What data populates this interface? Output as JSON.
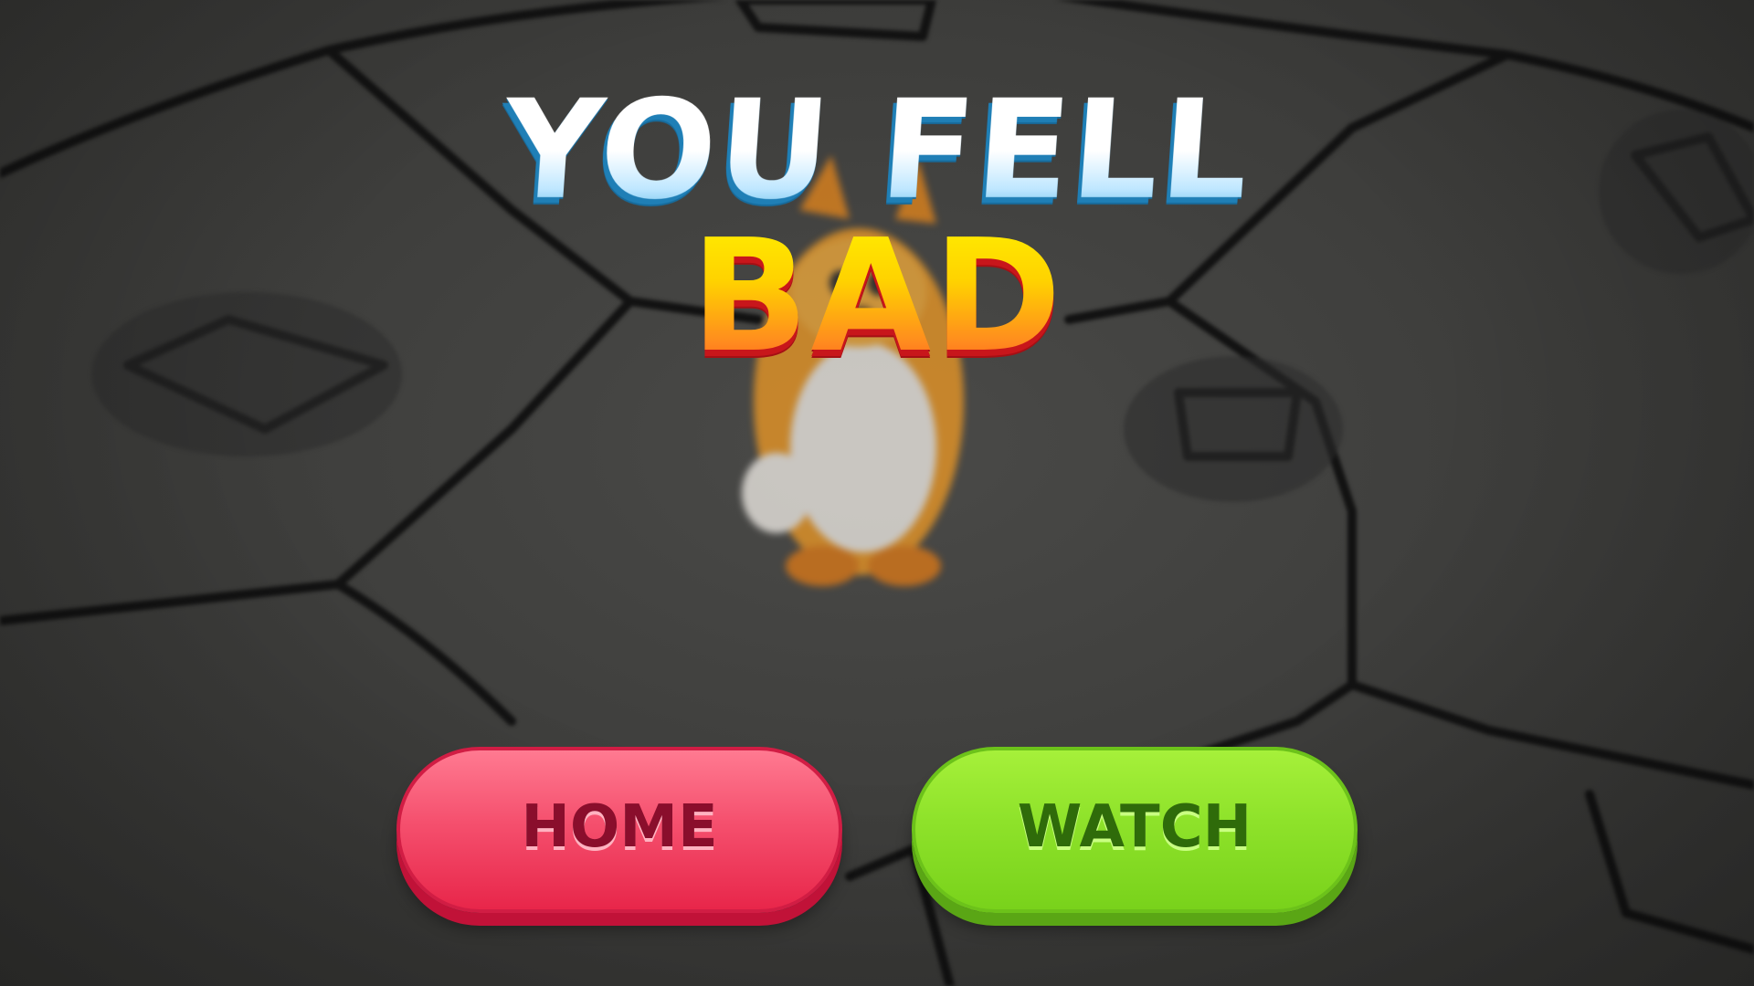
{
  "screen": {
    "title_line_1": "YOU FELL",
    "title_line_2": "BAD"
  },
  "buttons": {
    "home_label": "HOME",
    "watch_label": "WATCH"
  },
  "colors": {
    "home_button": "#f0445f",
    "watch_button": "#8ee22a",
    "title_top": "#ffffff",
    "title_bottom": "#ffb300",
    "background": "#3d3d3b"
  },
  "icons": {
    "character": "cartoon-hamster-character"
  }
}
